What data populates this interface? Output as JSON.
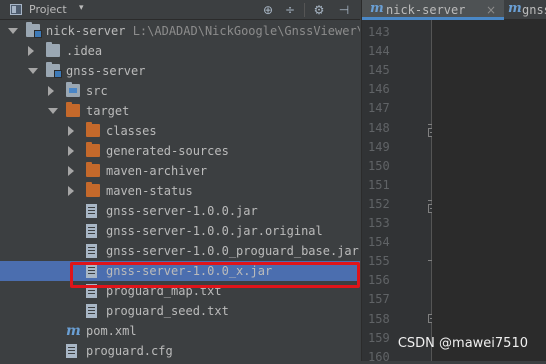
{
  "project_panel": {
    "title": "Project",
    "dropdown_glyph": "▾",
    "header_buttons": [
      {
        "icon": "sync-icon",
        "glyph": "⊕"
      },
      {
        "icon": "collapse-all-icon",
        "glyph": "÷"
      },
      {
        "icon": "settings-gear-icon",
        "glyph": "⚙"
      },
      {
        "icon": "hide-icon",
        "glyph": "⊣"
      }
    ],
    "tree": [
      {
        "label": "nick-server",
        "path": "L:\\ADADAD\\NickGoogle\\GnssViewer\\n",
        "type": "module-folder",
        "expanded": true,
        "depth": 0
      },
      {
        "label": ".idea",
        "type": "folder",
        "expanded": false,
        "depth": 1
      },
      {
        "label": "gnss-server",
        "type": "module-folder",
        "expanded": true,
        "depth": 1
      },
      {
        "label": "src",
        "type": "source-folder",
        "expanded": false,
        "depth": 2
      },
      {
        "label": "target",
        "type": "excluded-folder",
        "expanded": true,
        "depth": 2
      },
      {
        "label": "classes",
        "type": "excluded-folder",
        "expanded": false,
        "depth": 3
      },
      {
        "label": "generated-sources",
        "type": "excluded-folder",
        "expanded": false,
        "depth": 3
      },
      {
        "label": "maven-archiver",
        "type": "excluded-folder",
        "expanded": false,
        "depth": 3
      },
      {
        "label": "maven-status",
        "type": "excluded-folder",
        "expanded": false,
        "depth": 3
      },
      {
        "label": "gnss-server-1.0.0.jar",
        "type": "file",
        "depth": 3
      },
      {
        "label": "gnss-server-1.0.0.jar.original",
        "type": "file",
        "depth": 3
      },
      {
        "label": "gnss-server-1.0.0_proguard_base.jar",
        "type": "file",
        "depth": 3
      },
      {
        "label": "gnss-server-1.0.0_x.jar",
        "type": "file",
        "depth": 3,
        "selected": true
      },
      {
        "label": "proguard_map.txt",
        "type": "file",
        "depth": 3
      },
      {
        "label": "proguard_seed.txt",
        "type": "file",
        "depth": 3
      },
      {
        "label": "pom.xml",
        "type": "maven-file",
        "depth": 2
      },
      {
        "label": "proguard.cfg",
        "type": "file",
        "depth": 2
      }
    ]
  },
  "editor": {
    "tabs": [
      {
        "icon": "maven-icon",
        "label": "nick-server",
        "active": true,
        "close": "×"
      },
      {
        "icon": "maven-icon",
        "label": "gnss-s",
        "active": false
      }
    ],
    "line_numbers": [
      "143",
      "144",
      "145",
      "146",
      "147",
      "148",
      "149",
      "150",
      "151",
      "152",
      "153",
      "154",
      "155",
      "156",
      "157",
      "158",
      "159",
      "160"
    ]
  },
  "watermark": "CSDN @mawei7510",
  "colors": {
    "selection": "#4b6eaf",
    "highlight_box": "#e0141a",
    "excluded_folder": "#c5692b",
    "background": "#3c3f41"
  }
}
